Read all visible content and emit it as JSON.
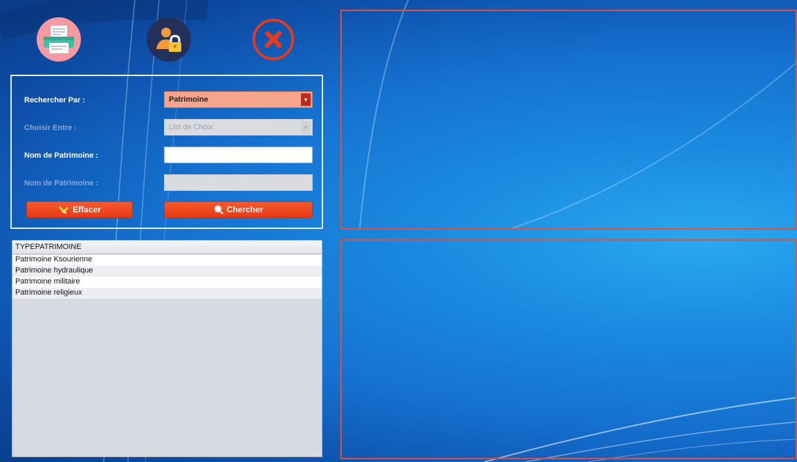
{
  "toolbar": {
    "print_icon": "printer-icon",
    "user_icon": "user-lock-icon",
    "close_icon": "close-icon",
    "accent_color": "#e53b1c"
  },
  "search_form": {
    "search_by_label": "Rechercher Par :",
    "search_by_value": "Patrimoine",
    "choose_label": "Choisir Entre :",
    "choose_value": "List de Choix",
    "name_label": "Nom de Patrimoine :",
    "name_value": "",
    "name2_label": "Nom de Patrimoine :",
    "name2_value": "",
    "clear_button": "Effacer",
    "search_button": "Chercher"
  },
  "table": {
    "header": "TYPEPATRIMOINE",
    "rows": [
      "Patrimoine Ksourienne",
      "Patrimoine hydraulique",
      "Patrimoine militaire",
      "Patrimoine religieux"
    ]
  }
}
